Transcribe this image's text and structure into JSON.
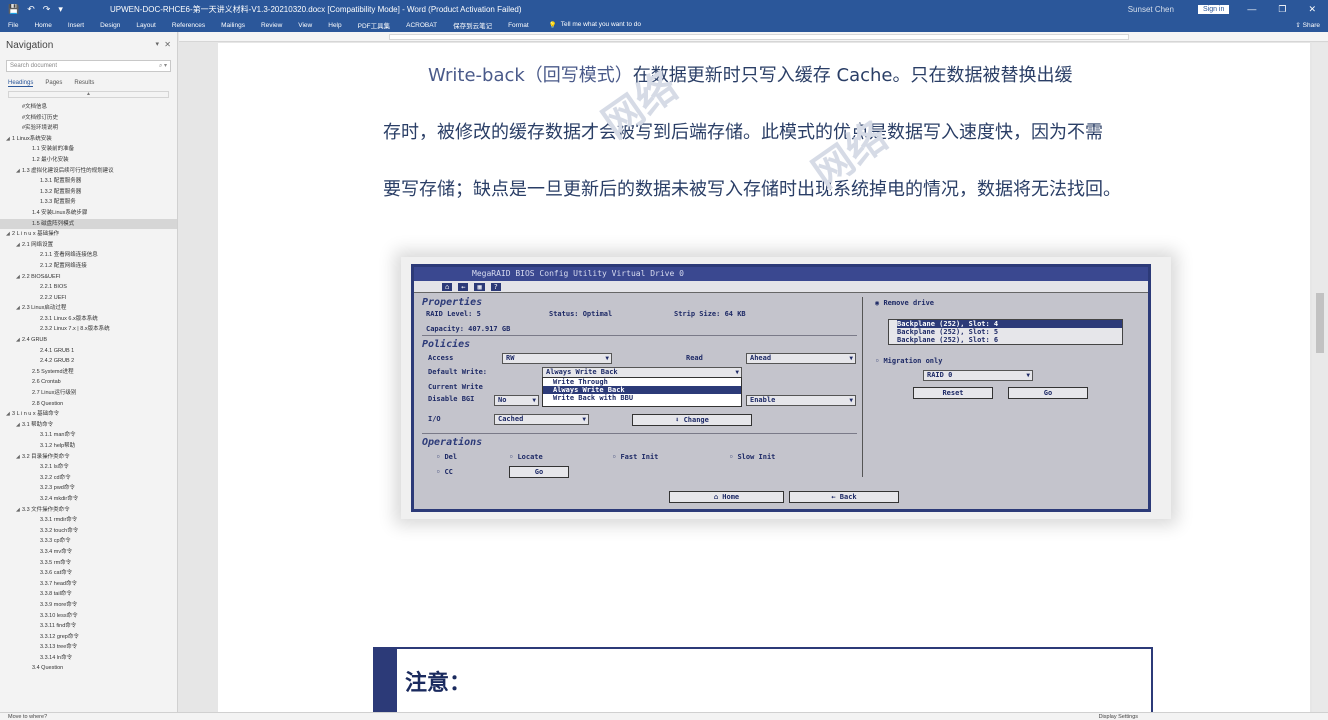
{
  "titlebar": {
    "title": "UPWEN-DOC-RHCE6-第一天讲义材料-V1.3-20210320.docx [Compatibility Mode] - Word (Product Activation Failed)",
    "user": "Sunset Chen",
    "sign_in": "Sign in",
    "minimize": "—",
    "restore": "❐",
    "close": "✕"
  },
  "ribbon": {
    "tabs": [
      "File",
      "Home",
      "Insert",
      "Design",
      "Layout",
      "References",
      "Mailings",
      "Review",
      "View",
      "Help",
      "PDF工具集",
      "ACROBAT",
      "保存到云笔记",
      "Format"
    ],
    "tell_me": "Tell me what you want to do",
    "share": "Share"
  },
  "navigation": {
    "title": "Navigation",
    "search_placeholder": "Search document",
    "tabs": [
      "Headings",
      "Pages",
      "Results"
    ],
    "items": [
      {
        "label": "#文档信息",
        "indent": 2
      },
      {
        "label": "#文档修订历史",
        "indent": 2
      },
      {
        "label": "#实验环境说明",
        "indent": 2
      },
      {
        "label": "1 Linux系统安装",
        "indent": 1,
        "caret": "◢"
      },
      {
        "label": "1.1 安装前的准备",
        "indent": 3
      },
      {
        "label": "1.2 最小化安装",
        "indent": 3
      },
      {
        "label": "1.3 虚拟化建设后续可行性的规划建议",
        "indent": 2,
        "caret": "◢"
      },
      {
        "label": "1.3.1 配置服务器",
        "indent": 4
      },
      {
        "label": "1.3.2 配置服务器",
        "indent": 4
      },
      {
        "label": "1.3.3 配置服务",
        "indent": 4
      },
      {
        "label": "1.4 安装Linux系统步骤",
        "indent": 3
      },
      {
        "label": "1.5 磁盘阵列模式",
        "indent": 3,
        "selected": true
      },
      {
        "label": "2 L i n u x 基础操作",
        "indent": 1,
        "caret": "◢"
      },
      {
        "label": "2.1 网络设置",
        "indent": 2,
        "caret": "◢"
      },
      {
        "label": "2.1.1 查看网络连接信息",
        "indent": 4
      },
      {
        "label": "2.1.2 配置网络连接",
        "indent": 4
      },
      {
        "label": "2.2 BIOS&UEFI",
        "indent": 2,
        "caret": "◢"
      },
      {
        "label": "2.2.1 BIOS",
        "indent": 4
      },
      {
        "label": "2.2.2 UEFI",
        "indent": 4
      },
      {
        "label": "2.3 Linux启动过程",
        "indent": 2,
        "caret": "◢"
      },
      {
        "label": "2.3.1 Linux 6.x版本系统",
        "indent": 4
      },
      {
        "label": "2.3.2 Linux 7.x | 8.x版本系统",
        "indent": 4
      },
      {
        "label": "2.4 GRUB",
        "indent": 2,
        "caret": "◢"
      },
      {
        "label": "2.4.1 GRUB 1",
        "indent": 4
      },
      {
        "label": "2.4.2 GRUB 2",
        "indent": 4
      },
      {
        "label": "2.5 Systemd进程",
        "indent": 3
      },
      {
        "label": "2.6 Crontab",
        "indent": 3
      },
      {
        "label": "2.7 Linux运行级别",
        "indent": 3
      },
      {
        "label": "2.8 Question",
        "indent": 3
      },
      {
        "label": "3 L i n u x 基础命令",
        "indent": 1,
        "caret": "◢"
      },
      {
        "label": "3.1 帮助命令",
        "indent": 2,
        "caret": "◢"
      },
      {
        "label": "3.1.1 man命令",
        "indent": 4
      },
      {
        "label": "3.1.2 help帮助",
        "indent": 4
      },
      {
        "label": "3.2 目录操作类命令",
        "indent": 2,
        "caret": "◢"
      },
      {
        "label": "3.2.1 ls命令",
        "indent": 4
      },
      {
        "label": "3.2.2 cd命令",
        "indent": 4
      },
      {
        "label": "3.2.3 pwd命令",
        "indent": 4
      },
      {
        "label": "3.2.4 mkdir命令",
        "indent": 4
      },
      {
        "label": "3.3 文件操作类命令",
        "indent": 2,
        "caret": "◢"
      },
      {
        "label": "3.3.1 rmdir命令",
        "indent": 4
      },
      {
        "label": "3.3.2 touch命令",
        "indent": 4
      },
      {
        "label": "3.3.3 cp命令",
        "indent": 4
      },
      {
        "label": "3.3.4 mv命令",
        "indent": 4
      },
      {
        "label": "3.3.5 rm命令",
        "indent": 4
      },
      {
        "label": "3.3.6 cat命令",
        "indent": 4
      },
      {
        "label": "3.3.7 head命令",
        "indent": 4
      },
      {
        "label": "3.3.8 tail命令",
        "indent": 4
      },
      {
        "label": "3.3.9 more命令",
        "indent": 4
      },
      {
        "label": "3.3.10 less命令",
        "indent": 4
      },
      {
        "label": "3.3.11 find命令",
        "indent": 4
      },
      {
        "label": "3.3.12 grep命令",
        "indent": 4
      },
      {
        "label": "3.3.13 tree命令",
        "indent": 4
      },
      {
        "label": "3.3.14 ln命令",
        "indent": 4
      },
      {
        "label": "3.4 Question",
        "indent": 3
      }
    ]
  },
  "document": {
    "line1_prefix": "Write-back（回写模式）",
    "line1_rest": "在数据更新时只写入缓存 Cache。只在数据被替换出缓",
    "line2": "存时，被修改的缓存数据才会被写到后端存储。此模式的优点是数据写入速度快，因为不需",
    "line3": "要写存储；缺点是一旦更新后的数据未被写入存储时出现系统掉电的情况，数据将无法找回。",
    "note_label": "注意："
  },
  "bios": {
    "title": "MegaRAID BIOS Config Utility Virtual Drive 0",
    "properties": "Properties",
    "raid_level": "RAID Level: 5",
    "status": "Status: Optimal",
    "strip_size": "Strip Size: 64 KB",
    "capacity": "Capacity: 407.917 GB",
    "policies": "Policies",
    "access_label": "Access",
    "access_value": "RW",
    "read_label": "Read",
    "read_value": "Ahead",
    "default_write_label": "Default Write:",
    "default_write_value": "Always Write Back",
    "current_write_label": "Current Write",
    "disable_bgi_label": "Disable BGI",
    "disable_bgi_value": "No",
    "io_label": "I/O",
    "io_value": "Cached",
    "enable_value": "Enable",
    "change_button": "Change",
    "dropdown_options": [
      "Write Through",
      "Always Write Back",
      "Write Back with BBU"
    ],
    "operations": "Operations",
    "op_del": "Del",
    "op_locate": "Locate",
    "op_fast_init": "Fast Init",
    "op_slow_init": "Slow Init",
    "op_cc": "CC",
    "go_button": "Go",
    "home_button": "Home",
    "back_button": "Back",
    "remove_drive": "Remove drive",
    "list_items": [
      "Backplane (252), Slot: 4",
      "Backplane (252), Slot: 5",
      "Backplane (252), Slot: 6"
    ],
    "migration_only": "Migration only",
    "raid_select": "RAID 0",
    "reset_button": "Reset",
    "go2_button": "Go"
  },
  "status": {
    "page": "Move to where?",
    "display_settings": "Display Settings"
  },
  "colors": {
    "word_blue": "#2b579a",
    "bios_blue": "#2c3a78"
  }
}
